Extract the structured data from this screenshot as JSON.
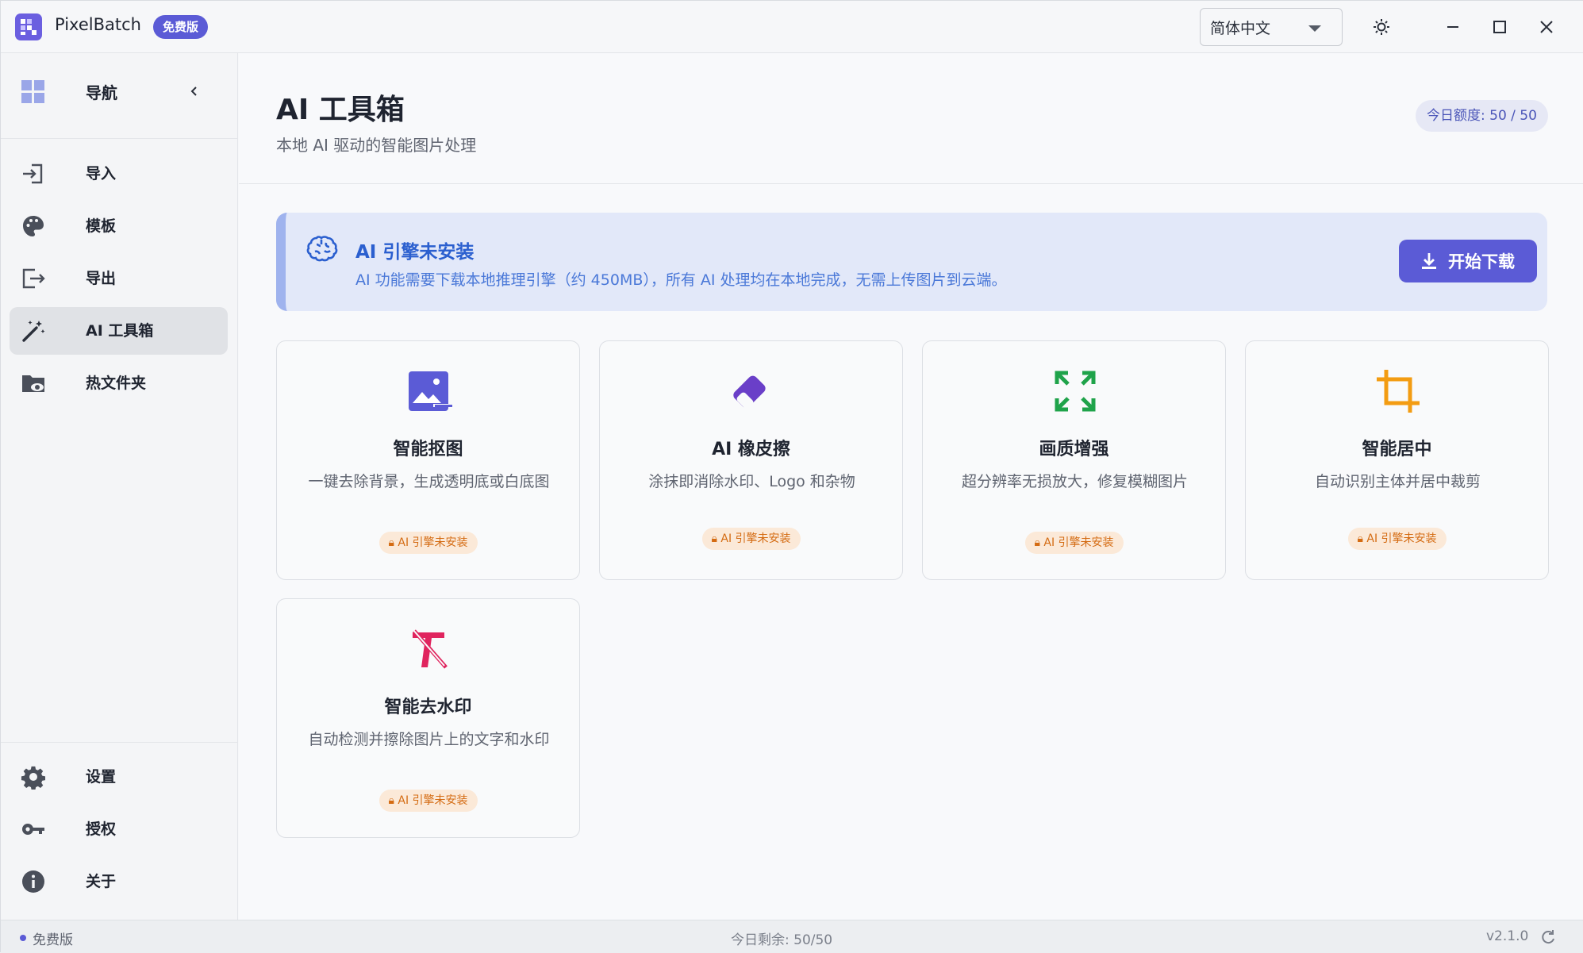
{
  "app": {
    "name": "PixelBatch",
    "edition_badge": "免费版"
  },
  "titlebar": {
    "language_value": "简体中文"
  },
  "sidebar": {
    "header_label": "导航",
    "items": [
      {
        "label": "导入",
        "icon": "import-icon"
      },
      {
        "label": "模板",
        "icon": "palette-icon"
      },
      {
        "label": "导出",
        "icon": "export-icon"
      },
      {
        "label": "AI 工具箱",
        "icon": "magic-wand-icon",
        "active": true
      },
      {
        "label": "热文件夹",
        "icon": "watch-folder-icon"
      }
    ],
    "bottom_items": [
      {
        "label": "设置",
        "icon": "gear-icon"
      },
      {
        "label": "授权",
        "icon": "key-icon"
      },
      {
        "label": "关于",
        "icon": "info-icon"
      }
    ]
  },
  "main": {
    "title": "AI 工具箱",
    "subtitle": "本地 AI 驱动的智能图片处理",
    "quota": "今日额度: 50 / 50",
    "banner": {
      "title": "AI 引擎未安装",
      "text": "AI 功能需要下载本地推理引擎（约 450MB），所有 AI 处理均在本地完成，无需上传图片到云端。",
      "button_label": "开始下载"
    },
    "tools": [
      {
        "title": "智能抠图",
        "desc": "一键去除背景，生成透明底或白底图",
        "tag": "AI 引擎未安装",
        "icon": "image-cutout-icon",
        "color": "#5b5bd6"
      },
      {
        "title": "AI 橡皮擦",
        "desc": "涂抹即消除水印、Logo 和杂物",
        "tag": "AI 引擎未安装",
        "icon": "eraser-icon",
        "color": "#6a3fc8"
      },
      {
        "title": "画质增强",
        "desc": "超分辨率无损放大，修复模糊图片",
        "tag": "AI 引擎未安装",
        "icon": "expand-icon",
        "color": "#1fa34a"
      },
      {
        "title": "智能居中",
        "desc": "自动识别主体并居中裁剪",
        "tag": "AI 引擎未安装",
        "icon": "crop-icon",
        "color": "#f39c12"
      },
      {
        "title": "智能去水印",
        "desc": "自动检测并擦除图片上的文字和水印",
        "tag": "AI 引擎未安装",
        "icon": "text-remove-icon",
        "color": "#e0245e"
      }
    ]
  },
  "statusbar": {
    "edition": "免费版",
    "remaining": "今日剩余: 50/50",
    "version": "v2.1.0"
  },
  "colors": {
    "accent": "#5b5bd6",
    "banner_bg": "#e2e8f9",
    "warning_tag": "#d46b12"
  }
}
